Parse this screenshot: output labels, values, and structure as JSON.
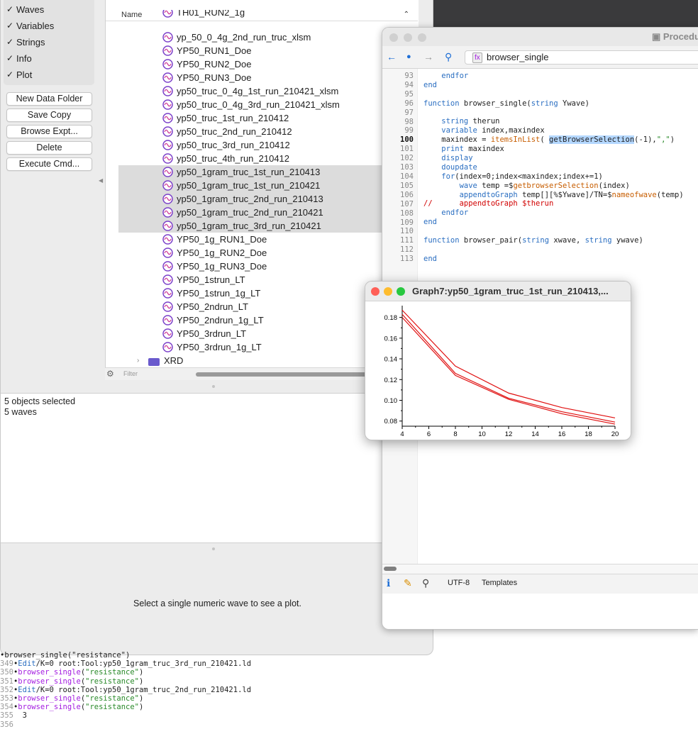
{
  "browser": {
    "checkboxes": [
      {
        "label": "Waves",
        "checked": true
      },
      {
        "label": "Variables",
        "checked": true
      },
      {
        "label": "Strings",
        "checked": true
      },
      {
        "label": "Info",
        "checked": true
      },
      {
        "label": "Plot",
        "checked": true
      }
    ],
    "buttons": [
      "New Data Folder",
      "Save Copy",
      "Browse Expt...",
      "Delete",
      "Execute Cmd..."
    ],
    "column_header": "Name",
    "waves": [
      {
        "name": "TH01_RUN2_1g",
        "selected": false
      },
      {
        "name": "yp_50_0_4g_2nd_run_truc_xlsm",
        "selected": false
      },
      {
        "name": "YP50_RUN1_Doe",
        "selected": false
      },
      {
        "name": "YP50_RUN2_Doe",
        "selected": false
      },
      {
        "name": "YP50_RUN3_Doe",
        "selected": false
      },
      {
        "name": "yp50_truc_0_4g_1st_run_210421_xlsm",
        "selected": false
      },
      {
        "name": "yp50_truc_0_4g_3rd_run_210421_xlsm",
        "selected": false
      },
      {
        "name": "yp50_truc_1st_run_210412",
        "selected": false
      },
      {
        "name": "yp50_truc_2nd_run_210412",
        "selected": false
      },
      {
        "name": "yp50_truc_3rd_run_210412",
        "selected": false
      },
      {
        "name": "yp50_truc_4th_run_210412",
        "selected": false
      },
      {
        "name": "yp50_1gram_truc_1st_run_210413",
        "selected": true
      },
      {
        "name": "yp50_1gram_truc_1st_run_210421",
        "selected": true
      },
      {
        "name": "yp50_1gram_truc_2nd_run_210413",
        "selected": true
      },
      {
        "name": "yp50_1gram_truc_2nd_run_210421",
        "selected": true
      },
      {
        "name": "yp50_1gram_truc_3rd_run_210421",
        "selected": true
      },
      {
        "name": "YP50_1g_RUN1_Doe",
        "selected": false
      },
      {
        "name": "YP50_1g_RUN2_Doe",
        "selected": false
      },
      {
        "name": "YP50_1g_RUN3_Doe",
        "selected": false
      },
      {
        "name": "YP50_1strun_LT",
        "selected": false
      },
      {
        "name": "YP50_1strun_1g_LT",
        "selected": false
      },
      {
        "name": "YP50_2ndrun_LT",
        "selected": false
      },
      {
        "name": "YP50_2ndrun_1g_LT",
        "selected": false
      },
      {
        "name": "YP50_3rdrun_LT",
        "selected": false
      },
      {
        "name": "YP50_3rdrun_1g_LT",
        "selected": false
      }
    ],
    "folder": "XRD",
    "filter_placeholder": "Filter",
    "info_lines": [
      "5 objects selected",
      "5 waves"
    ],
    "plot_message": "Select a single numeric wave to see a plot."
  },
  "console": [
    {
      "num": "",
      "parts": [
        {
          "t": "•browser_single(\"resistance\")",
          "c": ""
        }
      ]
    },
    {
      "num": "349",
      "parts": [
        {
          "t": "•",
          "c": ""
        },
        {
          "t": "Edit",
          "c": "kw"
        },
        {
          "t": "/K=0 root:Tool:yp50_1gram_truc_3rd_run_210421.ld",
          "c": ""
        }
      ]
    },
    {
      "num": "350",
      "parts": [
        {
          "t": "•",
          "c": ""
        },
        {
          "t": "browser_single",
          "c": "fn"
        },
        {
          "t": "(",
          "c": ""
        },
        {
          "t": "\"resistance\"",
          "c": "str"
        },
        {
          "t": ")",
          "c": ""
        }
      ]
    },
    {
      "num": "351",
      "parts": [
        {
          "t": "•",
          "c": ""
        },
        {
          "t": "browser_single",
          "c": "fn"
        },
        {
          "t": "(",
          "c": ""
        },
        {
          "t": "\"resistance\"",
          "c": "str"
        },
        {
          "t": ")",
          "c": ""
        }
      ]
    },
    {
      "num": "352",
      "parts": [
        {
          "t": "•",
          "c": ""
        },
        {
          "t": "Edit",
          "c": "kw"
        },
        {
          "t": "/K=0 root:Tool:yp50_1gram_truc_2nd_run_210421.ld",
          "c": ""
        }
      ]
    },
    {
      "num": "353",
      "parts": [
        {
          "t": "•",
          "c": ""
        },
        {
          "t": "browser_single",
          "c": "fn"
        },
        {
          "t": "(",
          "c": ""
        },
        {
          "t": "\"resistance\"",
          "c": "str"
        },
        {
          "t": ")",
          "c": ""
        }
      ]
    },
    {
      "num": "354",
      "parts": [
        {
          "t": "•",
          "c": ""
        },
        {
          "t": "browser_single",
          "c": "fn"
        },
        {
          "t": "(",
          "c": ""
        },
        {
          "t": "\"resistance\"",
          "c": "str"
        },
        {
          "t": ")",
          "c": ""
        }
      ]
    },
    {
      "num": "355",
      "parts": [
        {
          "t": "  3",
          "c": ""
        }
      ]
    },
    {
      "num": "356",
      "parts": [
        {
          "t": "",
          "c": ""
        }
      ]
    }
  ],
  "procedure": {
    "title": "Procedu",
    "function_selector": "browser_single",
    "status_encoding": "UTF-8",
    "status_templates": "Templates",
    "lines": [
      {
        "num": "93",
        "parts": [
          {
            "t": "    endfor",
            "c": "kw"
          }
        ]
      },
      {
        "num": "94",
        "parts": [
          {
            "t": "end",
            "c": "kw"
          }
        ]
      },
      {
        "num": "95",
        "parts": [
          {
            "t": "",
            "c": ""
          }
        ]
      },
      {
        "num": "96",
        "parts": [
          {
            "t": "function",
            "c": "kw"
          },
          {
            "t": " browser_single(",
            "c": ""
          },
          {
            "t": "string",
            "c": "kw"
          },
          {
            "t": " Ywave)",
            "c": ""
          }
        ]
      },
      {
        "num": "97",
        "parts": [
          {
            "t": "",
            "c": ""
          }
        ]
      },
      {
        "num": "98",
        "parts": [
          {
            "t": "    ",
            "c": ""
          },
          {
            "t": "string",
            "c": "kw"
          },
          {
            "t": " therun",
            "c": ""
          }
        ]
      },
      {
        "num": "99",
        "parts": [
          {
            "t": "    ",
            "c": ""
          },
          {
            "t": "variable",
            "c": "kw"
          },
          {
            "t": " index,maxindex",
            "c": ""
          }
        ]
      },
      {
        "num": "100",
        "parts": [
          {
            "t": "    maxindex = ",
            "c": ""
          },
          {
            "t": "itemsInList",
            "c": "op"
          },
          {
            "t": "( ",
            "c": ""
          },
          {
            "t": "getBrowserSelection",
            "c": "hl"
          },
          {
            "t": "(-1),",
            "c": ""
          },
          {
            "t": "\",\"",
            "c": "str"
          },
          {
            "t": ")",
            "c": ""
          }
        ]
      },
      {
        "num": "101",
        "parts": [
          {
            "t": "    ",
            "c": ""
          },
          {
            "t": "print",
            "c": "kw"
          },
          {
            "t": " maxindex",
            "c": ""
          }
        ]
      },
      {
        "num": "102",
        "parts": [
          {
            "t": "    display",
            "c": "kw"
          }
        ]
      },
      {
        "num": "103",
        "parts": [
          {
            "t": "    doupdate",
            "c": "kw"
          }
        ]
      },
      {
        "num": "104",
        "parts": [
          {
            "t": "    ",
            "c": ""
          },
          {
            "t": "for",
            "c": "kw"
          },
          {
            "t": "(index=0;index<maxindex;index+=1)",
            "c": ""
          }
        ]
      },
      {
        "num": "105",
        "parts": [
          {
            "t": "        ",
            "c": ""
          },
          {
            "t": "wave",
            "c": "kw"
          },
          {
            "t": " temp =$",
            "c": ""
          },
          {
            "t": "getbrowserSelection",
            "c": "op"
          },
          {
            "t": "(index)",
            "c": ""
          }
        ]
      },
      {
        "num": "106",
        "parts": [
          {
            "t": "        ",
            "c": ""
          },
          {
            "t": "appendtoGraph",
            "c": "kw"
          },
          {
            "t": " temp[][%$Ywave]/TN=$",
            "c": ""
          },
          {
            "t": "nameofwave",
            "c": "op"
          },
          {
            "t": "(temp)",
            "c": ""
          }
        ]
      },
      {
        "num": "107",
        "parts": [
          {
            "t": "//      appendtoGraph $therun",
            "c": "cm"
          }
        ]
      },
      {
        "num": "108",
        "parts": [
          {
            "t": "    endfor",
            "c": "kw"
          }
        ]
      },
      {
        "num": "109",
        "parts": [
          {
            "t": "end",
            "c": "kw"
          }
        ]
      },
      {
        "num": "110",
        "parts": [
          {
            "t": "",
            "c": ""
          }
        ]
      },
      {
        "num": "111",
        "parts": [
          {
            "t": "function",
            "c": "kw"
          },
          {
            "t": " browser_pair(",
            "c": ""
          },
          {
            "t": "string",
            "c": "kw"
          },
          {
            "t": " xwave, ",
            "c": ""
          },
          {
            "t": "string",
            "c": "kw"
          },
          {
            "t": " ywave)",
            "c": ""
          }
        ]
      },
      {
        "num": "112",
        "parts": [
          {
            "t": "",
            "c": ""
          }
        ]
      },
      {
        "num": "113",
        "parts": [
          {
            "t": "end",
            "c": "kw"
          }
        ]
      }
    ]
  },
  "graph": {
    "title": "Graph7:yp50_1gram_truc_1st_run_210413,...",
    "line_color": "#e01010"
  },
  "chart_data": {
    "type": "line",
    "x": [
      4,
      8,
      12,
      16,
      20
    ],
    "series": [
      {
        "values": [
          0.187,
          0.133,
          0.107,
          0.093,
          0.083
        ]
      },
      {
        "values": [
          0.183,
          0.126,
          0.102,
          0.089,
          0.079
        ]
      },
      {
        "values": [
          0.18,
          0.124,
          0.101,
          0.087,
          0.077
        ]
      }
    ],
    "xticks": [
      4,
      6,
      8,
      10,
      12,
      14,
      16,
      18,
      20
    ],
    "yticks": [
      0.08,
      0.1,
      0.12,
      0.14,
      0.16,
      0.18
    ],
    "xlim": [
      4,
      20
    ],
    "ylim": [
      0.075,
      0.19
    ],
    "xlabel": "",
    "ylabel": "",
    "grid": false
  }
}
